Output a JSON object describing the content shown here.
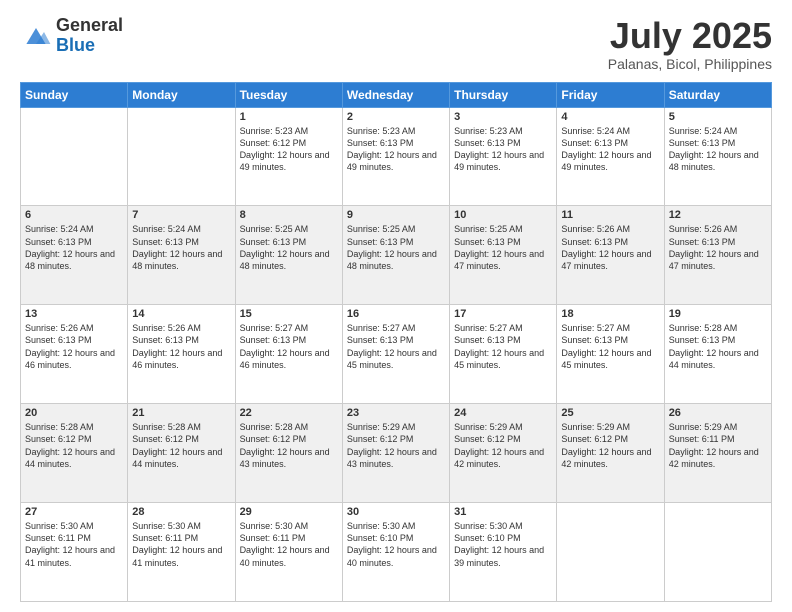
{
  "header": {
    "logo": {
      "general": "General",
      "blue": "Blue"
    },
    "title": "July 2025",
    "location": "Palanas, Bicol, Philippines"
  },
  "weekdays": [
    "Sunday",
    "Monday",
    "Tuesday",
    "Wednesday",
    "Thursday",
    "Friday",
    "Saturday"
  ],
  "weeks": [
    [
      {
        "day": null,
        "sunrise": null,
        "sunset": null,
        "daylight": null
      },
      {
        "day": null,
        "sunrise": null,
        "sunset": null,
        "daylight": null
      },
      {
        "day": "1",
        "sunrise": "Sunrise: 5:23 AM",
        "sunset": "Sunset: 6:12 PM",
        "daylight": "Daylight: 12 hours and 49 minutes."
      },
      {
        "day": "2",
        "sunrise": "Sunrise: 5:23 AM",
        "sunset": "Sunset: 6:13 PM",
        "daylight": "Daylight: 12 hours and 49 minutes."
      },
      {
        "day": "3",
        "sunrise": "Sunrise: 5:23 AM",
        "sunset": "Sunset: 6:13 PM",
        "daylight": "Daylight: 12 hours and 49 minutes."
      },
      {
        "day": "4",
        "sunrise": "Sunrise: 5:24 AM",
        "sunset": "Sunset: 6:13 PM",
        "daylight": "Daylight: 12 hours and 49 minutes."
      },
      {
        "day": "5",
        "sunrise": "Sunrise: 5:24 AM",
        "sunset": "Sunset: 6:13 PM",
        "daylight": "Daylight: 12 hours and 48 minutes."
      }
    ],
    [
      {
        "day": "6",
        "sunrise": "Sunrise: 5:24 AM",
        "sunset": "Sunset: 6:13 PM",
        "daylight": "Daylight: 12 hours and 48 minutes."
      },
      {
        "day": "7",
        "sunrise": "Sunrise: 5:24 AM",
        "sunset": "Sunset: 6:13 PM",
        "daylight": "Daylight: 12 hours and 48 minutes."
      },
      {
        "day": "8",
        "sunrise": "Sunrise: 5:25 AM",
        "sunset": "Sunset: 6:13 PM",
        "daylight": "Daylight: 12 hours and 48 minutes."
      },
      {
        "day": "9",
        "sunrise": "Sunrise: 5:25 AM",
        "sunset": "Sunset: 6:13 PM",
        "daylight": "Daylight: 12 hours and 48 minutes."
      },
      {
        "day": "10",
        "sunrise": "Sunrise: 5:25 AM",
        "sunset": "Sunset: 6:13 PM",
        "daylight": "Daylight: 12 hours and 47 minutes."
      },
      {
        "day": "11",
        "sunrise": "Sunrise: 5:26 AM",
        "sunset": "Sunset: 6:13 PM",
        "daylight": "Daylight: 12 hours and 47 minutes."
      },
      {
        "day": "12",
        "sunrise": "Sunrise: 5:26 AM",
        "sunset": "Sunset: 6:13 PM",
        "daylight": "Daylight: 12 hours and 47 minutes."
      }
    ],
    [
      {
        "day": "13",
        "sunrise": "Sunrise: 5:26 AM",
        "sunset": "Sunset: 6:13 PM",
        "daylight": "Daylight: 12 hours and 46 minutes."
      },
      {
        "day": "14",
        "sunrise": "Sunrise: 5:26 AM",
        "sunset": "Sunset: 6:13 PM",
        "daylight": "Daylight: 12 hours and 46 minutes."
      },
      {
        "day": "15",
        "sunrise": "Sunrise: 5:27 AM",
        "sunset": "Sunset: 6:13 PM",
        "daylight": "Daylight: 12 hours and 46 minutes."
      },
      {
        "day": "16",
        "sunrise": "Sunrise: 5:27 AM",
        "sunset": "Sunset: 6:13 PM",
        "daylight": "Daylight: 12 hours and 45 minutes."
      },
      {
        "day": "17",
        "sunrise": "Sunrise: 5:27 AM",
        "sunset": "Sunset: 6:13 PM",
        "daylight": "Daylight: 12 hours and 45 minutes."
      },
      {
        "day": "18",
        "sunrise": "Sunrise: 5:27 AM",
        "sunset": "Sunset: 6:13 PM",
        "daylight": "Daylight: 12 hours and 45 minutes."
      },
      {
        "day": "19",
        "sunrise": "Sunrise: 5:28 AM",
        "sunset": "Sunset: 6:13 PM",
        "daylight": "Daylight: 12 hours and 44 minutes."
      }
    ],
    [
      {
        "day": "20",
        "sunrise": "Sunrise: 5:28 AM",
        "sunset": "Sunset: 6:12 PM",
        "daylight": "Daylight: 12 hours and 44 minutes."
      },
      {
        "day": "21",
        "sunrise": "Sunrise: 5:28 AM",
        "sunset": "Sunset: 6:12 PM",
        "daylight": "Daylight: 12 hours and 44 minutes."
      },
      {
        "day": "22",
        "sunrise": "Sunrise: 5:28 AM",
        "sunset": "Sunset: 6:12 PM",
        "daylight": "Daylight: 12 hours and 43 minutes."
      },
      {
        "day": "23",
        "sunrise": "Sunrise: 5:29 AM",
        "sunset": "Sunset: 6:12 PM",
        "daylight": "Daylight: 12 hours and 43 minutes."
      },
      {
        "day": "24",
        "sunrise": "Sunrise: 5:29 AM",
        "sunset": "Sunset: 6:12 PM",
        "daylight": "Daylight: 12 hours and 42 minutes."
      },
      {
        "day": "25",
        "sunrise": "Sunrise: 5:29 AM",
        "sunset": "Sunset: 6:12 PM",
        "daylight": "Daylight: 12 hours and 42 minutes."
      },
      {
        "day": "26",
        "sunrise": "Sunrise: 5:29 AM",
        "sunset": "Sunset: 6:11 PM",
        "daylight": "Daylight: 12 hours and 42 minutes."
      }
    ],
    [
      {
        "day": "27",
        "sunrise": "Sunrise: 5:30 AM",
        "sunset": "Sunset: 6:11 PM",
        "daylight": "Daylight: 12 hours and 41 minutes."
      },
      {
        "day": "28",
        "sunrise": "Sunrise: 5:30 AM",
        "sunset": "Sunset: 6:11 PM",
        "daylight": "Daylight: 12 hours and 41 minutes."
      },
      {
        "day": "29",
        "sunrise": "Sunrise: 5:30 AM",
        "sunset": "Sunset: 6:11 PM",
        "daylight": "Daylight: 12 hours and 40 minutes."
      },
      {
        "day": "30",
        "sunrise": "Sunrise: 5:30 AM",
        "sunset": "Sunset: 6:10 PM",
        "daylight": "Daylight: 12 hours and 40 minutes."
      },
      {
        "day": "31",
        "sunrise": "Sunrise: 5:30 AM",
        "sunset": "Sunset: 6:10 PM",
        "daylight": "Daylight: 12 hours and 39 minutes."
      },
      {
        "day": null,
        "sunrise": null,
        "sunset": null,
        "daylight": null
      },
      {
        "day": null,
        "sunrise": null,
        "sunset": null,
        "daylight": null
      }
    ]
  ]
}
